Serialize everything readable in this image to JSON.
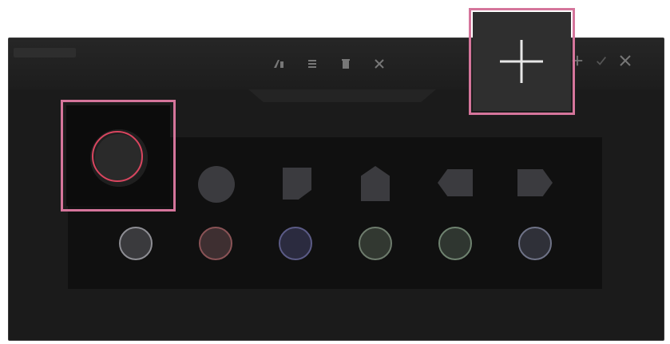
{
  "toolbar": {
    "top_icons": [
      "edit-icon",
      "list-icon",
      "delete-icon",
      "close-icon"
    ],
    "right_icons": [
      "plus-icon",
      "check-icon",
      "close-icon"
    ]
  },
  "shapes_row1": [
    "circle",
    "square",
    "pentagon",
    "arrow-left",
    "arrow-right"
  ],
  "colors_row2": [
    {
      "fill": "#3a3a3d",
      "stroke": "#8e8e94"
    },
    {
      "fill": "#3e2f31",
      "stroke": "#8a5356"
    },
    {
      "fill": "#2b2b3f",
      "stroke": "#5b5b86"
    },
    {
      "fill": "#323831",
      "stroke": "#6e7c6d"
    },
    {
      "fill": "#2f3630",
      "stroke": "#6f8370"
    },
    {
      "fill": "#2f3038",
      "stroke": "#6f7387"
    }
  ],
  "highlight_color": "#d5759b"
}
